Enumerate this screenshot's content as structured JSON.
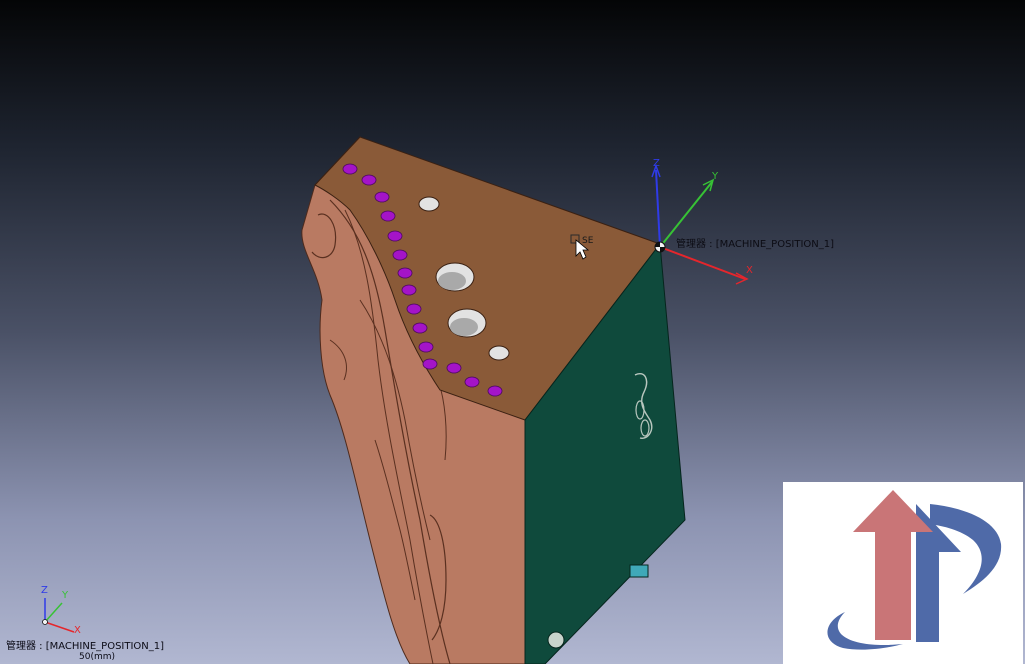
{
  "viewport": {
    "machine_position_label": "管理器 : [MACHINE_POSITION_1]",
    "cursor_tag": "SE",
    "axes": {
      "x": "X",
      "y": "Y",
      "z": "Z"
    }
  },
  "corner_triad": {
    "machine_position_label": "管理器 : [MACHINE_POSITION_1]",
    "scale_label": "50(mm)",
    "axes": {
      "x": "X",
      "y": "Y",
      "z": "Z"
    }
  },
  "colors": {
    "axis_x": "#e5262c",
    "axis_y": "#37c235",
    "axis_z": "#2f3be8",
    "part_top": "#8a5a38",
    "part_side": "#b97a62",
    "part_front": "#0f4a3c",
    "holes": "#a414c8",
    "logo_red": "#c97577",
    "logo_blue": "#4f6aa8"
  }
}
